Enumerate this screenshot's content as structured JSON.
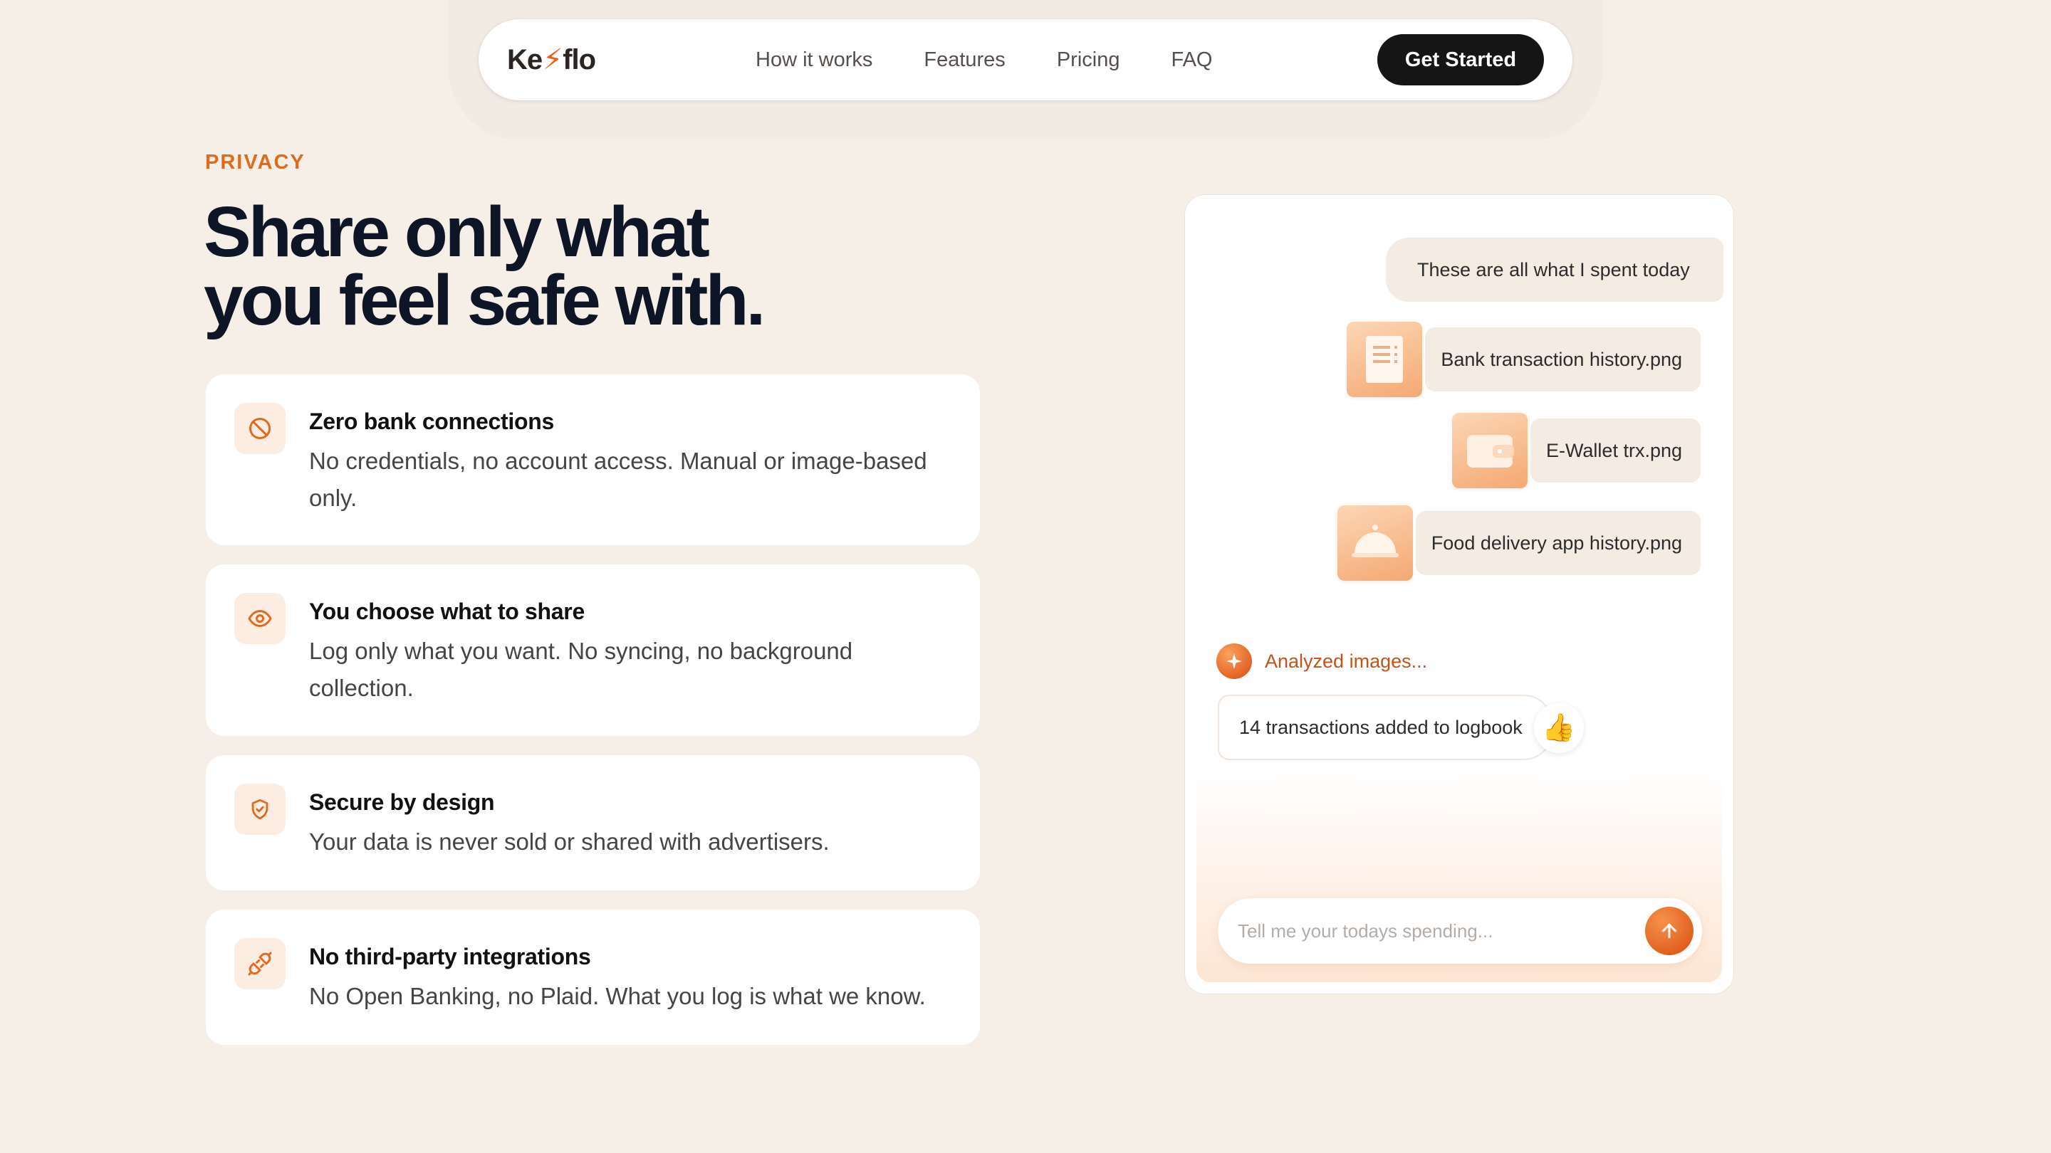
{
  "nav": {
    "logo": {
      "prefix": "Ke",
      "mark": "⚡",
      "suffix": "flo"
    },
    "links": [
      "How it works",
      "Features",
      "Pricing",
      "FAQ"
    ],
    "cta": "Get Started"
  },
  "hero": {
    "eyebrow": "PRIVACY",
    "headline_line1": "Share only what",
    "headline_line2": "you feel safe with."
  },
  "features": [
    {
      "icon": "ban-icon",
      "title": "Zero bank connections",
      "desc": "No credentials, no account access. Manual or image-based only."
    },
    {
      "icon": "eye-icon",
      "title": "You choose what to share",
      "desc": "Log only what you want. No syncing, no background collection."
    },
    {
      "icon": "shield-check-icon",
      "title": "Secure by design",
      "desc": "Your data is never sold or shared with advertisers."
    },
    {
      "icon": "unplug-icon",
      "title": "No third-party integrations",
      "desc": "No Open Banking, no Plaid. What you log is what we know."
    }
  ],
  "chat": {
    "user_message": "These are all what I spent today",
    "attachments": [
      {
        "icon": "receipt-icon",
        "name": "Bank transaction history.png"
      },
      {
        "icon": "wallet-icon",
        "name": "E-Wallet trx.png"
      },
      {
        "icon": "food-cloche-icon",
        "name": "Food delivery app history.png"
      }
    ],
    "status": "Analyzed images...",
    "result": "14 transactions added to logbook",
    "reaction": "👍",
    "input_placeholder": "Tell me your todays spending..."
  },
  "colors": {
    "background": "#f6efe8",
    "accent": "#e26a1d",
    "heading": "#0e1526",
    "cta_bg": "#151515"
  }
}
